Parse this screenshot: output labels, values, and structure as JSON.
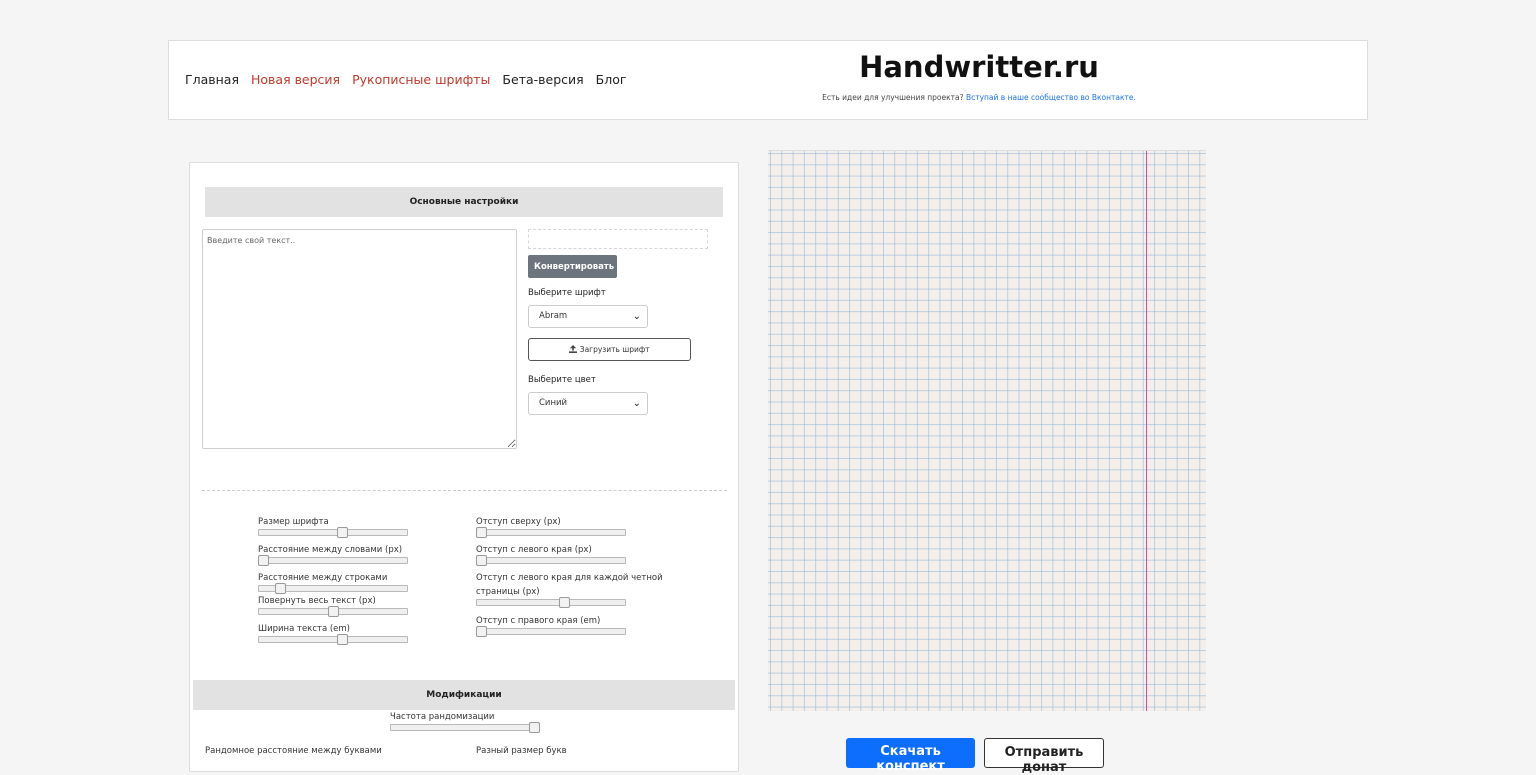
{
  "nav": {
    "items": [
      {
        "label": "Главная",
        "style": "dark"
      },
      {
        "label": "Новая версия",
        "style": "red"
      },
      {
        "label": "Рукописные шрифты",
        "style": "red"
      },
      {
        "label": "Бета-версия",
        "style": "dark"
      },
      {
        "label": "Блог",
        "style": "dark"
      }
    ]
  },
  "brand": {
    "title": "Handwritter.ru",
    "sub_text": "Есть идеи для улучшения проекта? ",
    "sub_link": "Вступай в наше сообщество во Вконтакте."
  },
  "settings": {
    "main_heading": "Основные настройки",
    "textarea_placeholder": "Введите свой текст..",
    "convert_label": "Конвертировать",
    "font_label": "Выберите шрифт",
    "font_value": "Abram",
    "upload_label": "Загрузить шрифт",
    "color_label": "Выберите цвет",
    "color_value": "Синий"
  },
  "sliders_left": [
    {
      "label": "Размер шрифта",
      "value": 0.57
    },
    {
      "label": "Расстояние междy словами (px)",
      "value": 0.0
    },
    {
      "label": "Расстояние между строками",
      "value": 0.12
    },
    {
      "label": "Повернуть весь текст (px)",
      "value": 0.5
    },
    {
      "label": "Ширина текста (em)",
      "value": 0.57
    }
  ],
  "sliders_right": [
    {
      "label": "Отступ сверху (px)",
      "value": 0.0
    },
    {
      "label": "Отступ с левого края (px)",
      "value": 0.0
    },
    {
      "label": "Отступ с левого края для каждой четной",
      "label2": "страницы (px)",
      "value": 0.6
    },
    {
      "label": "Отступ с правого края (em)",
      "value": 0.0
    }
  ],
  "modifications": {
    "heading": "Модификации",
    "random_freq_label": "Частота рандомизации",
    "random_freq_value": 1.0,
    "random_spacing_label": "Рандомное расстояние между буквами",
    "random_size_label": "Разный размер букв"
  },
  "actions": {
    "download_label": "Скачать конспект",
    "donate_label": "Отправить донат"
  },
  "colors": {
    "nav_red": "#c0392b",
    "link_blue": "#1a73e8",
    "convert_gray": "#6c757d",
    "download_blue": "#0d6efd",
    "paper_margin": "#e0489a",
    "paper_grid": "#8cb4d7"
  }
}
